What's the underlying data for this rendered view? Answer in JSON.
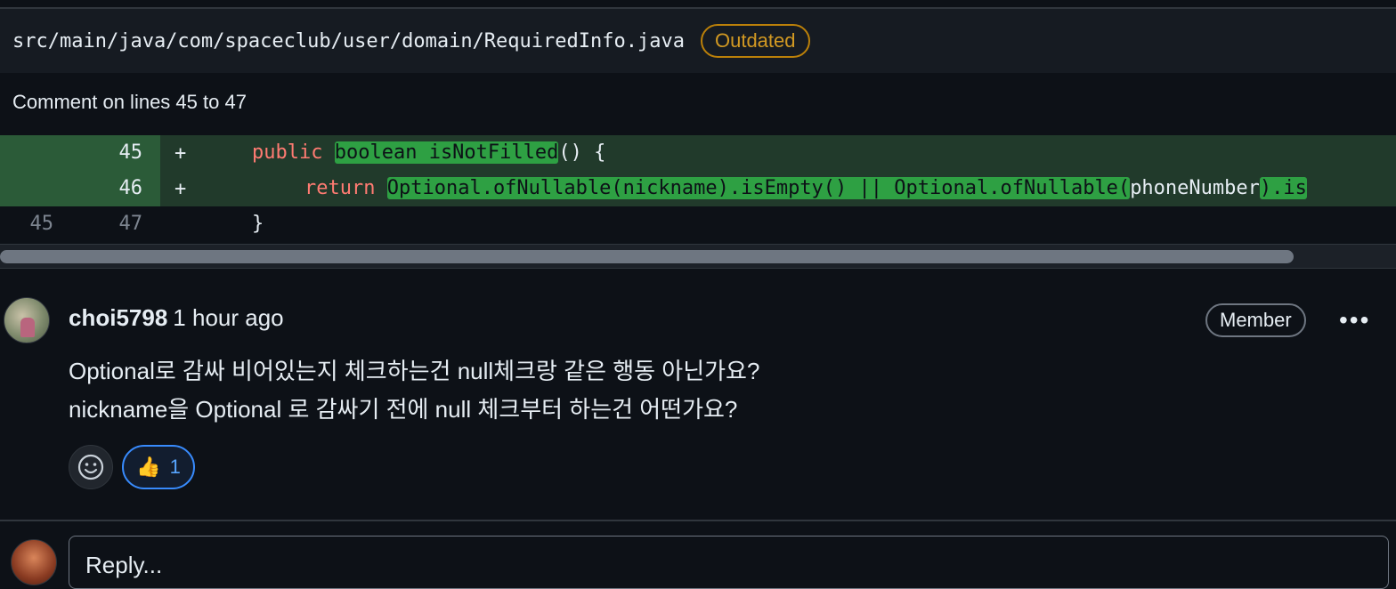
{
  "file": {
    "path": "src/main/java/com/spaceclub/user/domain/RequiredInfo.java",
    "badge": "Outdated"
  },
  "comment_range": "Comment on lines 45 to 47",
  "diff": {
    "rows": [
      {
        "old": "",
        "new": "45",
        "marker": "+"
      },
      {
        "old": "",
        "new": "46",
        "marker": "+"
      },
      {
        "old": "45",
        "new": "47",
        "marker": ""
      }
    ],
    "code": {
      "line1": {
        "kw": "public",
        "hl": "boolean isNotFilled",
        "rest": "() {"
      },
      "line2": {
        "kw": "return",
        "hl1": "Optional.ofNullable(nickname).isEmpty() || Optional.ofNullable(",
        "plain": "phoneNumber",
        "hl2": ").is"
      },
      "line3": "}"
    }
  },
  "comment": {
    "author": "choi5798",
    "time": "1 hour ago",
    "role": "Member",
    "more": "•••",
    "body_line1": "Optional로 감싸 비어있는지 체크하는건 null체크랑 같은 행동 아닌가요?",
    "body_line2": "nickname을 Optional 로 감싸기 전에 null 체크부터 하는건 어떤가요?",
    "reaction_emoji": "👍",
    "reaction_count": "1"
  },
  "reply": {
    "placeholder": "Reply..."
  },
  "colors": {
    "background": "#0d1117",
    "add_line": "#213a2b",
    "highlight": "#2ea043",
    "outdated": "#d29922",
    "reaction_border": "#388bfd"
  }
}
